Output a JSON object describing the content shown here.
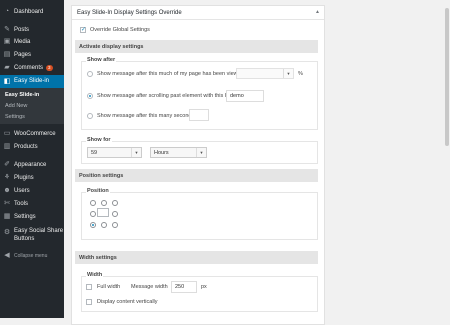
{
  "sidebar": {
    "items": [
      {
        "label": "Dashboard",
        "icon": "dashboard-icon"
      },
      {
        "label": "Posts",
        "icon": "pushpin-icon"
      },
      {
        "label": "Media",
        "icon": "media-icon"
      },
      {
        "label": "Pages",
        "icon": "pages-icon"
      },
      {
        "label": "Comments",
        "icon": "comments-icon",
        "badge": "3"
      },
      {
        "label": "Easy Slide-in",
        "icon": "slide-in-icon"
      },
      {
        "label": "WooCommerce",
        "icon": "woocommerce-icon"
      },
      {
        "label": "Products",
        "icon": "products-icon"
      },
      {
        "label": "Appearance",
        "icon": "appearance-icon"
      },
      {
        "label": "Plugins",
        "icon": "plugins-icon"
      },
      {
        "label": "Users",
        "icon": "users-icon"
      },
      {
        "label": "Tools",
        "icon": "tools-icon"
      },
      {
        "label": "Settings",
        "icon": "settings-icon"
      },
      {
        "label": "Easy Social Share",
        "icon": "share-icon",
        "label2": "Buttons"
      },
      {
        "label": "Collapse menu",
        "icon": "collapse-icon"
      }
    ],
    "submenu": [
      "Easy Slide-in",
      "Add New",
      "Settings"
    ]
  },
  "panel": {
    "title": "Easy Slide-In Display Settings Override",
    "toggle": "▲",
    "override_label": "Override Global Settings",
    "activate": {
      "heading": "Activate display settings",
      "show_after_legend": "Show after",
      "opt_percent": "Show message after this much of my page has been viewed:",
      "percent_unit": "%",
      "opt_element": "Show message after scrolling past element with this ID: #",
      "element_value": "demo",
      "opt_seconds": "Show message after this many seconds:"
    },
    "show_for": {
      "legend": "Show for",
      "amount": "59",
      "unit": "Hours"
    },
    "position": {
      "heading": "Position settings",
      "legend": "Position"
    },
    "width": {
      "heading": "Width settings",
      "legend": "Width",
      "full_width_label": "Full width",
      "message_width_label": "Message width",
      "message_width_value": "250",
      "unit": "px",
      "vertical_label": "Display content vertically"
    }
  },
  "colors": {
    "sidebar_bg": "#23282d",
    "accent": "#0073aa",
    "submenu_bg": "#32373c"
  }
}
